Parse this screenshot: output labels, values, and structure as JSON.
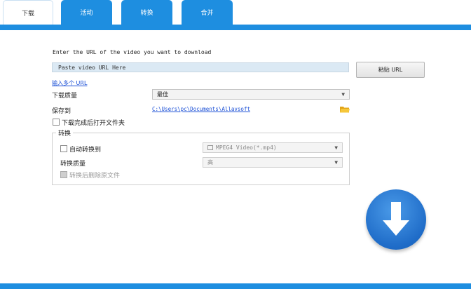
{
  "tabs": [
    {
      "label": "下载",
      "active": true
    },
    {
      "label": "活动",
      "active": false
    },
    {
      "label": "转换",
      "active": false
    },
    {
      "label": "合并",
      "active": false
    }
  ],
  "download": {
    "url_prompt": "Enter the URL of the video you want to download",
    "url_placeholder": "Paste video URL Here",
    "paste_button": "粘贴 URL",
    "multi_url_link": "输入多个 URL",
    "quality_label": "下载质量",
    "quality_value": "最佳",
    "save_label": "保存到",
    "save_path": "C:\\Users\\pc\\Documents\\Allavsoft",
    "open_folder_label": "下载完成后打开文件夹",
    "open_folder_checked": false
  },
  "convert": {
    "group_title": "转换",
    "auto_convert_label": "自动转换到",
    "auto_convert_checked": false,
    "format_value": "MPEG4 Video(*.mp4)",
    "quality_label": "转换质量",
    "quality_value": "高",
    "delete_original_label": "转换后删除原文件",
    "delete_original_enabled": false
  },
  "icons": {
    "folder": "folder-icon",
    "download": "download-arrow-icon",
    "format": "video-format-icon"
  },
  "colors": {
    "accent": "#1e8ee0",
    "link": "#1a4fd6",
    "input_bg": "#dbe9f4",
    "download_button": "#2a7bd8",
    "folder": "#f0b928"
  }
}
